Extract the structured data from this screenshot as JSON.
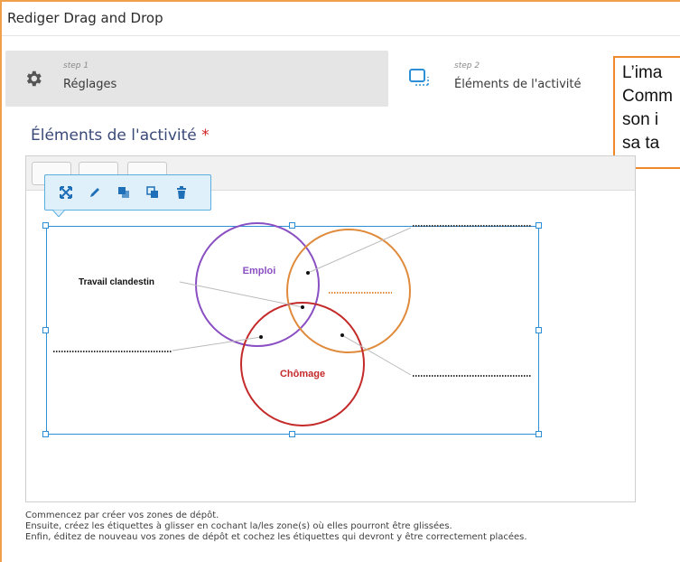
{
  "window": {
    "title": "Rediger Drag and Drop"
  },
  "steps": [
    {
      "small": "step 1",
      "label": "Réglages",
      "icon": "gear-icon"
    },
    {
      "small": "step 2",
      "label": "Éléments de l'activité",
      "icon": "drop-zone-icon"
    }
  ],
  "callout": {
    "lines": [
      "L’ima",
      "Comm",
      "son i",
      "sa ta"
    ]
  },
  "section": {
    "title": "Éléments de l'activité",
    "required_marker": "*"
  },
  "popover": {
    "buttons": [
      "expand-icon",
      "pencil-icon",
      "bring-front-icon",
      "send-back-icon",
      "trash-icon"
    ]
  },
  "diagram": {
    "labels": {
      "emploi": "Emploi",
      "chomage": "Chômage",
      "travail": "Travail clandestin"
    },
    "colors": {
      "emploi": "#8a4fc2",
      "chomage": "#c42a2a",
      "orange": "#e08a3c",
      "handles": "#2f8fd6"
    }
  },
  "instructions": [
    "Commencez par créer vos zones de dépôt.",
    "Ensuite, créez les étiquettes à glisser en cochant la/les zone(s) où elles pourront être glissées.",
    "Enfin, éditez de nouveau vos zones de dépôt et cochez les étiquettes qui devront y être correctement placées."
  ]
}
